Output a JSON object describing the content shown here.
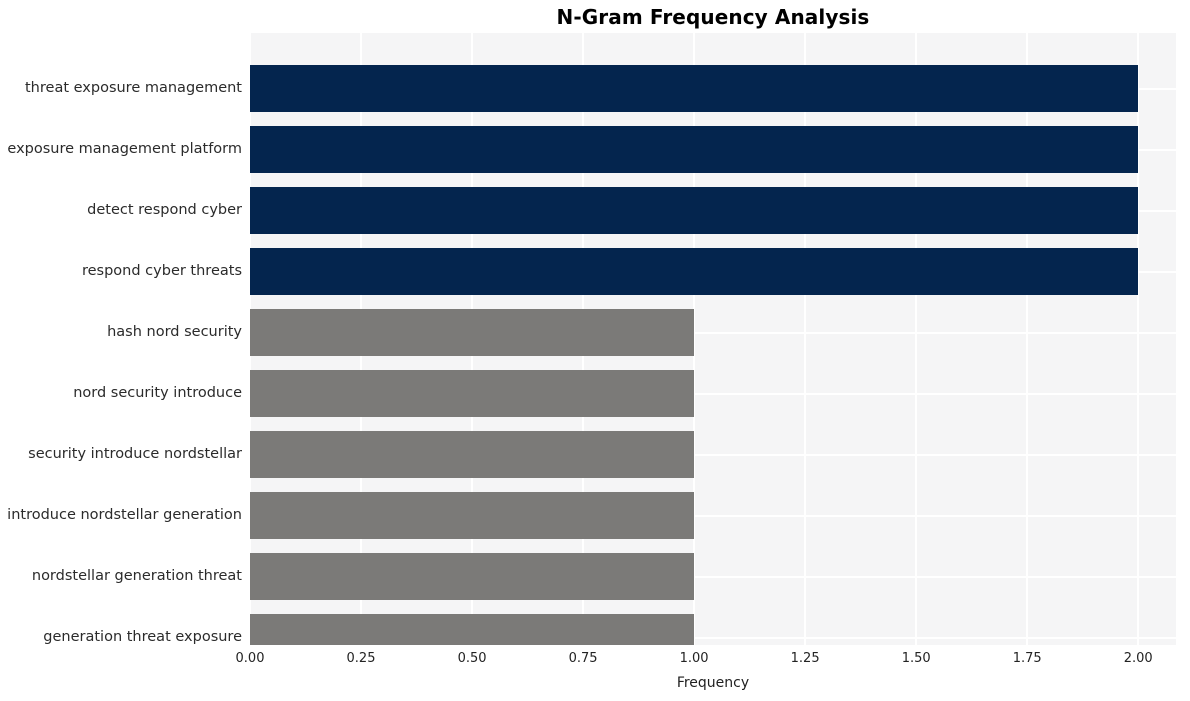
{
  "chart_data": {
    "type": "bar",
    "orientation": "horizontal",
    "title": "N-Gram Frequency Analysis",
    "xlabel": "Frequency",
    "ylabel": "",
    "xlim": [
      0.0,
      2.085
    ],
    "xticks": [
      "0.00",
      "0.25",
      "0.50",
      "0.75",
      "1.00",
      "1.25",
      "1.50",
      "1.75",
      "2.00"
    ],
    "xtick_values": [
      0.0,
      0.25,
      0.5,
      0.75,
      1.0,
      1.25,
      1.5,
      1.75,
      2.0
    ],
    "grid": true,
    "legend": "none",
    "categories": [
      "threat exposure management",
      "exposure management platform",
      "detect respond cyber",
      "respond cyber threats",
      "hash nord security",
      "nord security introduce",
      "security introduce nordstellar",
      "introduce nordstellar generation",
      "nordstellar generation threat",
      "generation threat exposure"
    ],
    "values": [
      2,
      2,
      2,
      2,
      1,
      1,
      1,
      1,
      1,
      1
    ],
    "bar_colors": [
      "#04254e",
      "#04254e",
      "#04254e",
      "#04254e",
      "#7b7a78",
      "#7b7a78",
      "#7b7a78",
      "#7b7a78",
      "#7b7a78",
      "#7b7a78"
    ],
    "colors": {
      "high_frequency": "#04254e",
      "low_frequency": "#7b7a78",
      "plot_background": "#f5f5f6",
      "grid": "#ffffff",
      "figure_background": "#ffffff",
      "title": "#000000",
      "tick_label": "#232323"
    }
  }
}
